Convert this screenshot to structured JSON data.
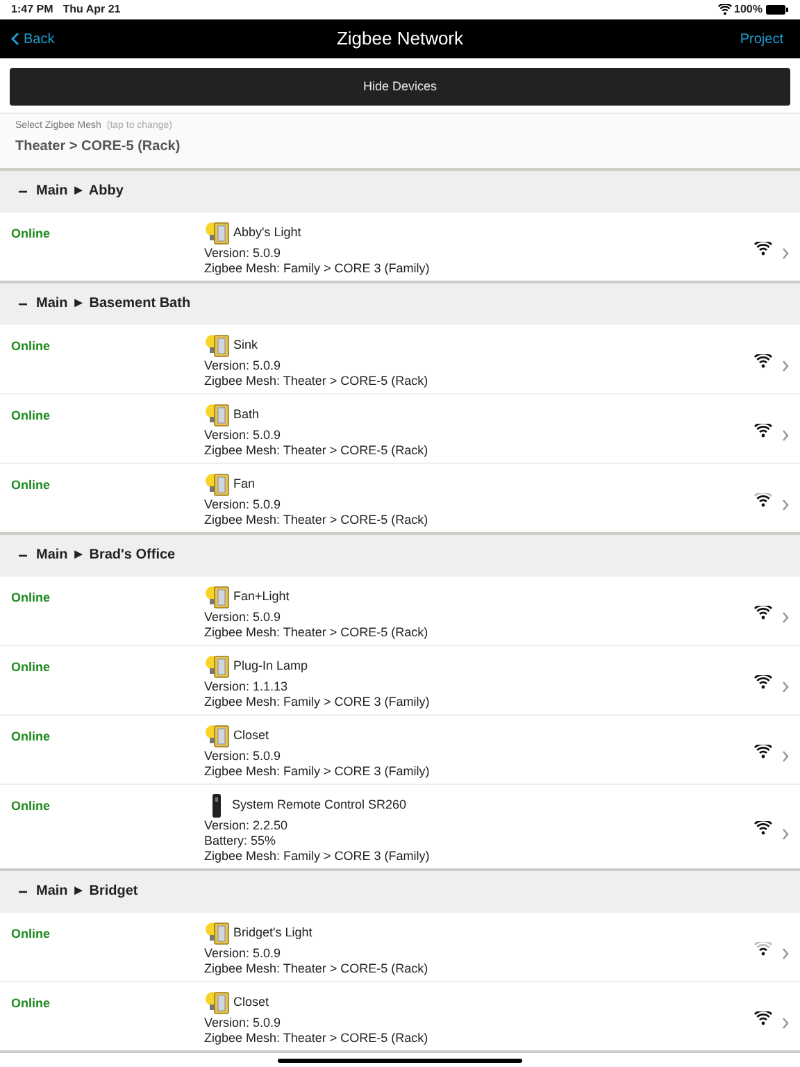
{
  "status_bar": {
    "time": "1:47 PM",
    "date": "Thu Apr 21",
    "battery": "100%"
  },
  "nav": {
    "back": "Back",
    "title": "Zigbee Network",
    "action": "Project"
  },
  "hide_button": "Hide Devices",
  "mesh_selector": {
    "label": "Select Zigbee Mesh",
    "hint": "(tap to change)",
    "value": "Theater > CORE-5 (Rack)"
  },
  "groups": [
    {
      "collapse": "−",
      "title": "Main ► Abby",
      "devices": [
        {
          "status": "Online",
          "kind": "light",
          "name": "Abby's Light",
          "details": [
            "Version: 5.0.9",
            "Zigbee Mesh: Family > CORE 3 (Family)"
          ],
          "signal": {
            "kind": "strong"
          }
        }
      ]
    },
    {
      "collapse": "−",
      "title": "Main ► Basement Bath",
      "devices": [
        {
          "status": "Online",
          "kind": "light",
          "name": "Sink",
          "details": [
            "Version: 5.0.9",
            "Zigbee Mesh: Theater > CORE-5 (Rack)"
          ],
          "signal": {
            "kind": "strong"
          }
        },
        {
          "status": "Online",
          "kind": "light",
          "name": "Bath",
          "details": [
            "Version: 5.0.9",
            "Zigbee Mesh: Theater > CORE-5 (Rack)"
          ],
          "signal": {
            "kind": "strong"
          }
        },
        {
          "status": "Online",
          "kind": "light",
          "name": "Fan",
          "details": [
            "Version: 5.0.9",
            "Zigbee Mesh: Theater > CORE-5 (Rack)"
          ],
          "signal": {
            "kind": "medium"
          }
        }
      ]
    },
    {
      "collapse": "−",
      "title": "Main ► Brad's Office",
      "devices": [
        {
          "status": "Online",
          "kind": "light",
          "name": "Fan+Light",
          "details": [
            "Version: 5.0.9",
            "Zigbee Mesh: Theater > CORE-5 (Rack)"
          ],
          "signal": {
            "kind": "strong"
          }
        },
        {
          "status": "Online",
          "kind": "light",
          "name": "Plug-In Lamp",
          "details": [
            "Version: 1.1.13",
            "Zigbee Mesh: Family > CORE 3 (Family)"
          ],
          "signal": {
            "kind": "strong"
          }
        },
        {
          "status": "Online",
          "kind": "light",
          "name": "Closet",
          "details": [
            "Version: 5.0.9",
            "Zigbee Mesh: Family > CORE 3 (Family)"
          ],
          "signal": {
            "kind": "strong"
          }
        },
        {
          "status": "Online",
          "kind": "remote",
          "name": "System Remote Control SR260",
          "details": [
            "Version: 2.2.50",
            "Battery: 55%",
            "Zigbee Mesh: Family > CORE 3 (Family)"
          ],
          "signal": {
            "kind": "strong"
          }
        }
      ]
    },
    {
      "collapse": "−",
      "title": "Main ► Bridget",
      "devices": [
        {
          "status": "Online",
          "kind": "light",
          "name": "Bridget's Light",
          "details": [
            "Version: 5.0.9",
            "Zigbee Mesh: Theater > CORE-5 (Rack)"
          ],
          "signal": {
            "kind": "weak"
          }
        },
        {
          "status": "Online",
          "kind": "light",
          "name": "Closet",
          "details": [
            "Version: 5.0.9",
            "Zigbee Mesh: Theater > CORE-5 (Rack)"
          ],
          "signal": {
            "kind": "strong"
          }
        }
      ]
    }
  ]
}
